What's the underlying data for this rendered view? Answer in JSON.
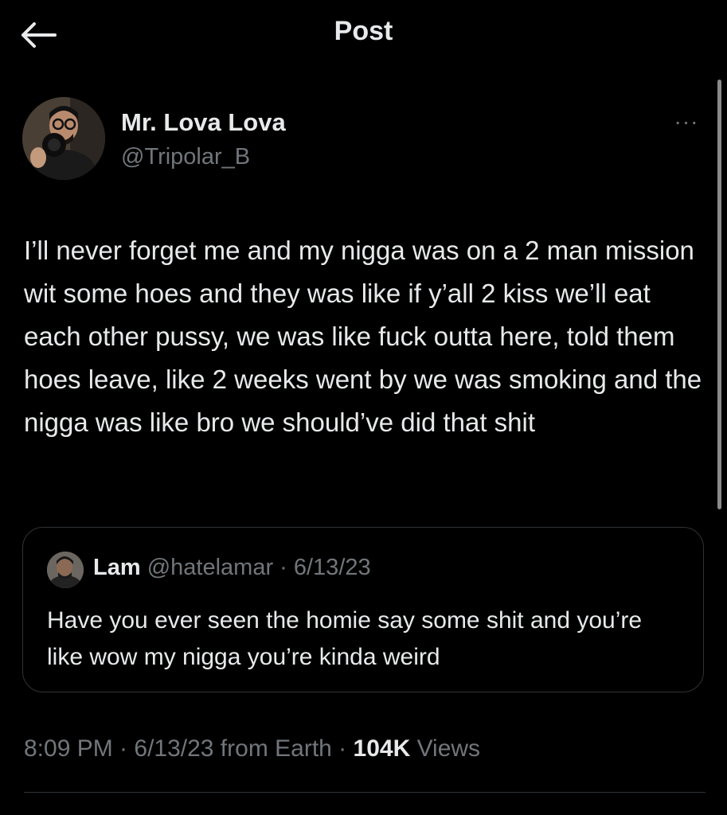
{
  "header": {
    "title": "Post",
    "back_icon": "arrow-left-icon"
  },
  "author": {
    "display_name": "Mr. Lova Lova",
    "handle": "@Tripolar_B",
    "avatar_icon": "avatar-photo",
    "more_icon": "more-options-icon",
    "more_glyph": "···"
  },
  "tweet": {
    "text": "I’ll never forget me and my nigga was on a 2 man mission wit some hoes and they was like if y’all 2 kiss we’ll eat each other pussy, we was like fuck outta here, told them hoes leave, like 2 weeks went by we was smoking and the nigga was like bro we should’ve did that shit"
  },
  "quote": {
    "name": "Lam",
    "handle_date": "@hatelamar · 6/13/23",
    "text": "Have you ever seen the homie say some shit and you’re like wow my nigga you’re kinda weird"
  },
  "meta": {
    "timestamp": "8:09 PM · 6/13/23 from Earth · ",
    "views_count": "104K",
    "views_label": " Views"
  },
  "colors": {
    "background": "#000000",
    "primary_text": "#e7e9ea",
    "secondary_text": "#71767b",
    "border": "#2f3336"
  }
}
